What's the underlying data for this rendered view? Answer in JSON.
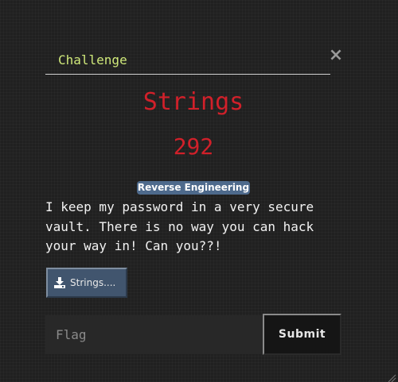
{
  "modal": {
    "tab_title": "Challenge",
    "close_symbol": "×"
  },
  "challenge": {
    "name": "Strings",
    "value": "292",
    "category": "Reverse Engineering",
    "description": "I keep my password in a very secure vault. There is no way you can hack your way in! Can you??!"
  },
  "files": {
    "label": "Strings....",
    "icon": "download-icon"
  },
  "submission": {
    "flag_placeholder": "Flag",
    "flag_value": "",
    "submit_label": "Submit"
  },
  "colors": {
    "accent_title": "#cfe87a",
    "challenge_red": "#d1202a",
    "tag_bg": "#4e6a8c",
    "file_button_bg": "#41556e"
  }
}
